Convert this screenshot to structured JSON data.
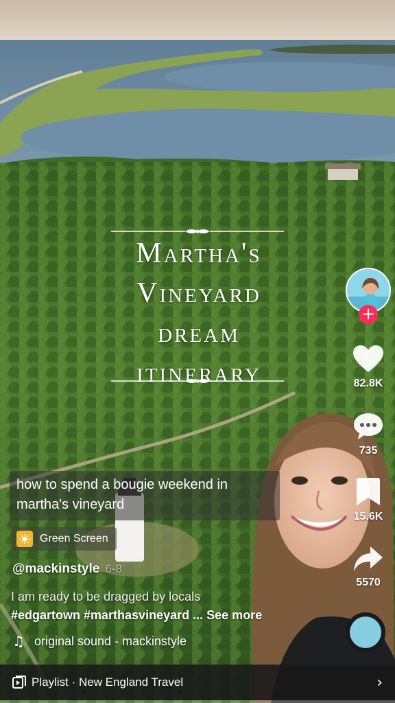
{
  "overlay_title": {
    "lines": [
      "Martha's",
      "Vineyard",
      "dream",
      "itinerary"
    ]
  },
  "creator": {
    "username": "@mackinstyle",
    "date": "6-8",
    "follow_symbol": "+"
  },
  "actions": {
    "likes": "82.8K",
    "comments": "735",
    "saves": "15.6K",
    "shares": "5570"
  },
  "caption": "how to spend a bougie weekend in martha's vineyard",
  "effect": {
    "label": "Green Screen",
    "icon": "green-screen-effect-icon"
  },
  "description": {
    "text": "I am ready to be dragged by locals",
    "hashtags": "#edgartown #marthasvineyard",
    "ellipsis": "...",
    "see_more": "See more"
  },
  "sound": {
    "label": "original sound - mackinstyle",
    "icon": "music-note-icon"
  },
  "playlist": {
    "label": "Playlist · New England Travel",
    "chevron": "›"
  },
  "playback_progress": 0.0,
  "colors": {
    "follow": "#fe2c55",
    "effect_icon": "#f5b534"
  }
}
